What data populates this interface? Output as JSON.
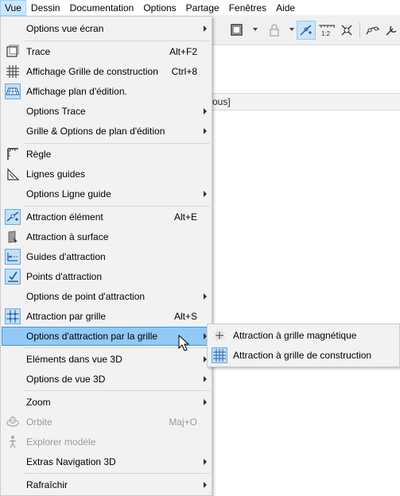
{
  "menubar": {
    "items": [
      "Vue",
      "Dessin",
      "Documentation",
      "Options",
      "Partage",
      "Fenêtres",
      "Aide"
    ],
    "active": "Vue"
  },
  "toolbar": {
    "icons": [
      "box-icon",
      "dropdown-arrow",
      "lock-icon",
      "dropdown-arrow",
      "magnet-snap-icon",
      "ruler-scale-icon",
      "snap-points-icon",
      "separator",
      "curve-icon",
      "tool-icon"
    ]
  },
  "list_header": {
    "text": "ous]"
  },
  "menu": {
    "items": [
      {
        "label": "Options vue écran",
        "shortcut": "",
        "submenu": true,
        "icon": ""
      },
      {
        "label": "Trace",
        "shortcut": "Alt+F2",
        "submenu": false,
        "icon": "trace-icon"
      },
      {
        "label": "Affichage Grille de construction",
        "shortcut": "Ctrl+8",
        "submenu": false,
        "icon": "grid-icon"
      },
      {
        "label": "Affichage plan d'édition.",
        "shortcut": "",
        "submenu": false,
        "icon": "edit-plane-icon"
      },
      {
        "label": "Options Trace",
        "shortcut": "",
        "submenu": true,
        "icon": ""
      },
      {
        "label": "Grille & Options de plan d'édition",
        "shortcut": "",
        "submenu": true,
        "icon": ""
      },
      {
        "label": "Règle",
        "shortcut": "",
        "submenu": false,
        "icon": "ruler-icon"
      },
      {
        "label": "Lignes guides",
        "shortcut": "",
        "submenu": false,
        "icon": "guide-lines-icon"
      },
      {
        "label": "Options Ligne guide",
        "shortcut": "",
        "submenu": true,
        "icon": ""
      },
      {
        "label": "Attraction élément",
        "shortcut": "Alt+E",
        "submenu": false,
        "icon": "element-snap-icon"
      },
      {
        "label": "Attraction à surface",
        "shortcut": "",
        "submenu": false,
        "icon": "surface-snap-icon"
      },
      {
        "label": "Guides d'attraction",
        "shortcut": "",
        "submenu": false,
        "icon": "snap-guides-icon"
      },
      {
        "label": "Points d'attraction",
        "shortcut": "",
        "submenu": false,
        "icon": "snap-points-icon"
      },
      {
        "label": "Options de point d'attraction",
        "shortcut": "",
        "submenu": true,
        "icon": ""
      },
      {
        "label": "Attraction par grille",
        "shortcut": "Alt+S",
        "submenu": false,
        "icon": "grid-snap-icon"
      },
      {
        "label": "Options d'attraction par la grille",
        "shortcut": "",
        "submenu": true,
        "icon": ""
      },
      {
        "label": "Eléments dans vue 3D",
        "shortcut": "",
        "submenu": true,
        "icon": ""
      },
      {
        "label": "Options de vue 3D",
        "shortcut": "",
        "submenu": true,
        "icon": ""
      },
      {
        "label": "Zoom",
        "shortcut": "",
        "submenu": true,
        "icon": ""
      },
      {
        "label": "Orbite",
        "shortcut": "Maj+O",
        "submenu": false,
        "icon": "orbit-icon"
      },
      {
        "label": "Explorer modèle",
        "shortcut": "",
        "submenu": false,
        "icon": "walk-icon"
      },
      {
        "label": "Extras Navigation 3D",
        "shortcut": "",
        "submenu": true,
        "icon": ""
      },
      {
        "label": "Rafraîchir",
        "shortcut": "",
        "submenu": true,
        "icon": ""
      }
    ],
    "highlighted": "Options d'attraction par la grille",
    "disabled": [
      "Orbite",
      "Explorer modèle"
    ],
    "checked": [
      "Affichage plan d'édition.",
      "Attraction élément",
      "Guides d'attraction",
      "Points d'attraction",
      "Attraction par grille"
    ]
  },
  "submenu": {
    "items": [
      {
        "label": "Attraction à grille magnétique",
        "icon": "magnetic-grid-icon"
      },
      {
        "label": "Attraction à grille de construction",
        "icon": "construction-grid-icon"
      }
    ],
    "checked": [
      "Attraction à grille de construction"
    ]
  },
  "colors": {
    "highlight": "#91c9f7",
    "highlight_border": "#3d97e0",
    "menu_bg": "#f2f2f2",
    "icon_accent": "#1f5fa8"
  }
}
